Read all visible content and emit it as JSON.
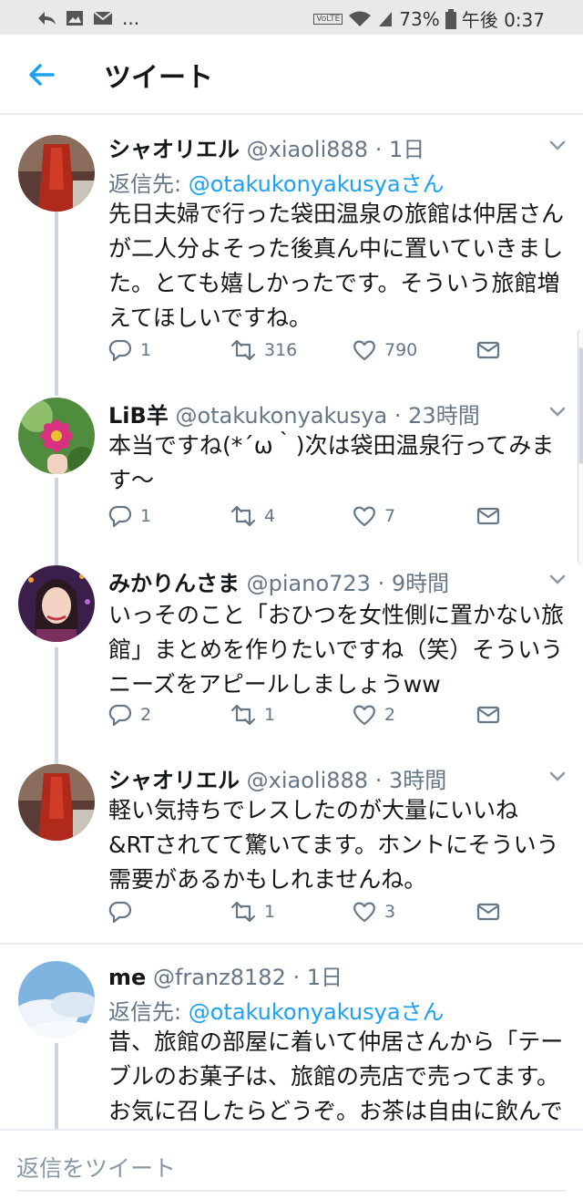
{
  "status_bar": {
    "volte": "VoLTE",
    "battery": "73%",
    "time": "午後 0:37"
  },
  "header": {
    "title": "ツイート"
  },
  "tweets": [
    {
      "name": "シャオリエル",
      "handle": "@xiaoli888",
      "time": "· 1日",
      "reply_prefix": "返信先: ",
      "reply_to": "@otakukonyakusyaさん",
      "text": "先日夫婦で行った袋田温泉の旅館は仲居さんが二人分よそった後真ん中に置いていきました。とても嬉しかったです。そういう旅館増えてほしいですね。",
      "replies": "1",
      "retweets": "316",
      "likes": "790"
    },
    {
      "name": "LiB羊",
      "handle": "@otakukonyakusya",
      "time": "· 23時間",
      "text": "本当ですね(*´ω｀)次は袋田温泉行ってみます〜",
      "replies": "1",
      "retweets": "4",
      "likes": "7"
    },
    {
      "name": "みかりんさま",
      "handle": "@piano723",
      "time": "· 9時間",
      "text": "いっそのこと「おひつを女性側に置かない旅館」まとめを作りたいですね（笑）そういうニーズをアピールしましょうww",
      "replies": "2",
      "retweets": "1",
      "likes": "2"
    },
    {
      "name": "シャオリエル",
      "handle": "@xiaoli888",
      "time": "· 3時間",
      "text": "軽い気持ちでレスしたのが大量にいいね&RTされてて驚いてます。ホントにそういう需要があるかもしれませんね。",
      "replies": "",
      "retweets": "1",
      "likes": "3"
    },
    {
      "name": "me",
      "handle": "@franz8182",
      "time": "· 1日",
      "reply_prefix": "返信先: ",
      "reply_to": "@otakukonyakusyaさん",
      "text": "昔、旅館の部屋に着いて仲居さんから「テーブルのお菓子は、旅館の売店で売ってます。お気に召したらどうぞ。お茶は自由に飲んでください。布団の上げ下ろしは自分でやって下さい"
    }
  ],
  "reply_bar": {
    "placeholder": "返信をツイート"
  },
  "colors": {
    "accent": "#1da1f2",
    "text": "#14171a",
    "muted": "#657786",
    "border": "#e6ecf0"
  }
}
